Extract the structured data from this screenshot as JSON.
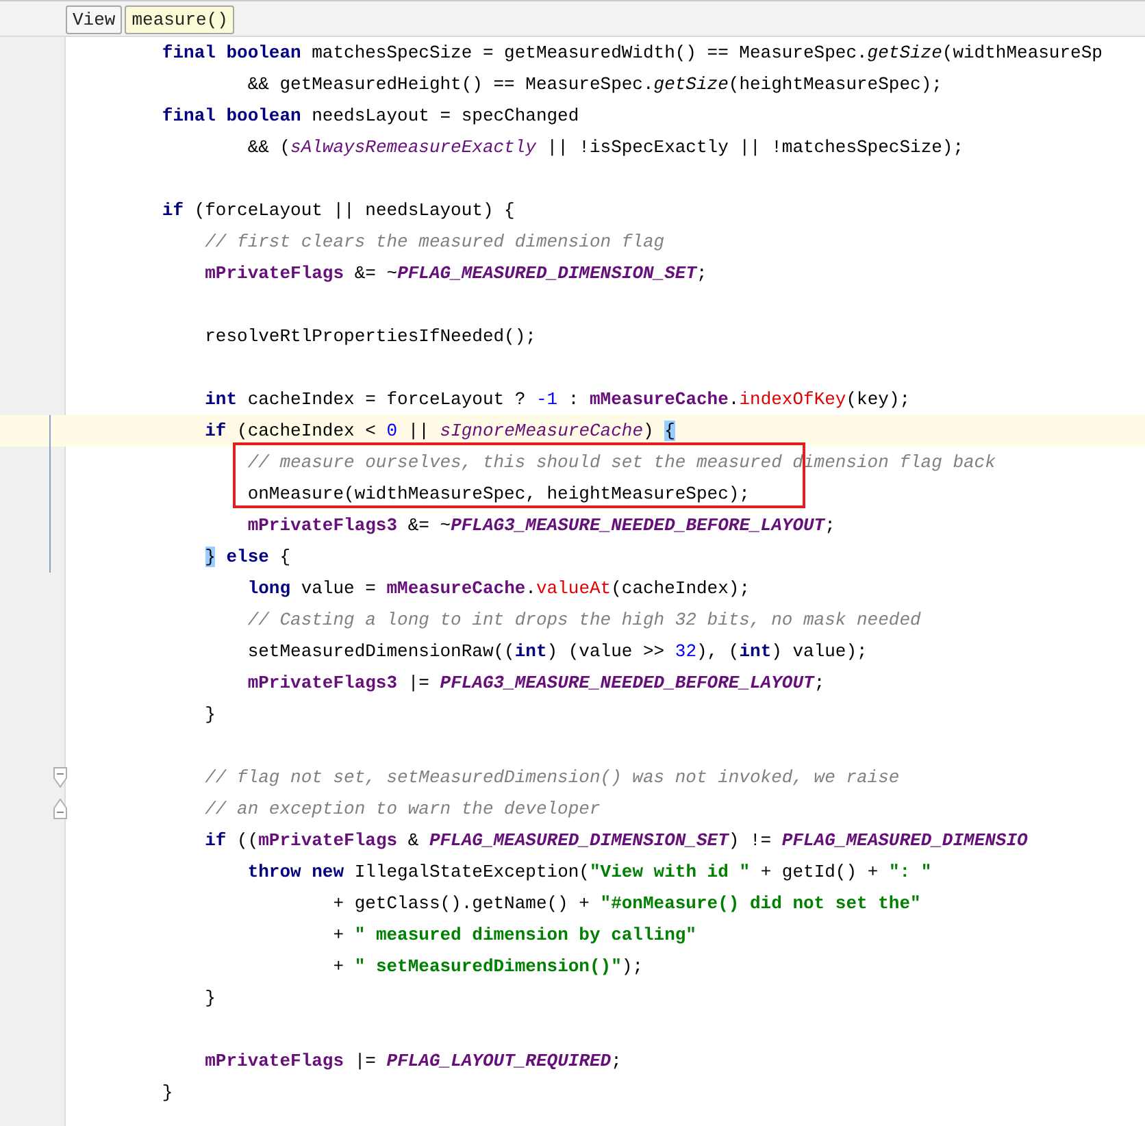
{
  "breadcrumbs": [
    {
      "label": "View",
      "selected": false
    },
    {
      "label": "measure()",
      "selected": true
    }
  ],
  "lines": [
    {
      "kind": "line",
      "current": false,
      "modified": false,
      "tokens": [
        {
          "t": "        final boolean",
          "kind": "keyword"
        },
        {
          "t": " matchesSpecSize = getMeasuredWidth() == MeasureSpec.",
          "kind": "plain"
        },
        {
          "t": "getSize",
          "kind": "italic"
        },
        {
          "t": "(widthMeasureSp",
          "kind": "plain"
        }
      ]
    },
    {
      "kind": "line",
      "current": false,
      "modified": false,
      "tokens": [
        {
          "t": "                && getMeasuredHeight() == MeasureSpec.",
          "kind": "plain"
        },
        {
          "t": "getSize",
          "kind": "italic"
        },
        {
          "t": "(heightMeasureSpec);",
          "kind": "plain"
        }
      ]
    },
    {
      "kind": "line",
      "current": false,
      "modified": false,
      "tokens": [
        {
          "t": "        final boolean",
          "kind": "keyword"
        },
        {
          "t": " needsLayout = specChanged",
          "kind": "plain"
        }
      ]
    },
    {
      "kind": "line",
      "current": false,
      "modified": false,
      "tokens": [
        {
          "t": "                && (",
          "kind": "plain"
        },
        {
          "t": "sAlwaysRemeasureExactly",
          "kind": "static"
        },
        {
          "t": " || !isSpecExactly || !matchesSpecSize);",
          "kind": "plain"
        }
      ]
    },
    {
      "kind": "line",
      "current": false,
      "modified": false
    },
    {
      "kind": "line",
      "current": false,
      "modified": false,
      "tokens": [
        {
          "t": "        if",
          "kind": "keyword"
        },
        {
          "t": " (forceLayout || needsLayout) {",
          "kind": "plain"
        }
      ]
    },
    {
      "kind": "line",
      "current": false,
      "modified": false,
      "tokens": [
        {
          "t": "            // first clears the measured dimension flag",
          "kind": "comment"
        }
      ]
    },
    {
      "kind": "line",
      "current": false,
      "modified": false,
      "tokens": [
        {
          "t": "            mPrivateFlags",
          "kind": "field"
        },
        {
          "t": " &= ~",
          "kind": "plain"
        },
        {
          "t": "PFLAG_MEASURED_DIMENSION_SET",
          "kind": "constant"
        },
        {
          "t": ";",
          "kind": "plain"
        }
      ]
    },
    {
      "kind": "line",
      "current": false,
      "modified": false
    },
    {
      "kind": "line",
      "current": false,
      "modified": false,
      "tokens": [
        {
          "t": "            resolveRtlPropertiesIfNeeded();",
          "kind": "plain"
        }
      ]
    },
    {
      "kind": "line",
      "current": false,
      "modified": false
    },
    {
      "kind": "line",
      "current": false,
      "modified": false,
      "tokens": [
        {
          "t": "            int",
          "kind": "keyword"
        },
        {
          "t": " cacheIndex = forceLayout ? ",
          "kind": "plain"
        },
        {
          "t": "-1",
          "kind": "number"
        },
        {
          "t": " : ",
          "kind": "plain"
        },
        {
          "t": "mMeasureCache",
          "kind": "field"
        },
        {
          "t": ".",
          "kind": "plain"
        },
        {
          "t": "indexOfKey",
          "kind": "call"
        },
        {
          "t": "(key);",
          "kind": "plain"
        }
      ]
    },
    {
      "kind": "line",
      "current": true,
      "modified": true,
      "tokens": [
        {
          "t": "            if",
          "kind": "keyword"
        },
        {
          "t": " (cacheIndex < ",
          "kind": "plain"
        },
        {
          "t": "0",
          "kind": "number"
        },
        {
          "t": " || ",
          "kind": "plain"
        },
        {
          "t": "sIgnoreMeasureCache",
          "kind": "static"
        },
        {
          "t": ") ",
          "kind": "plain"
        },
        {
          "t": "{",
          "kind": "brace"
        }
      ]
    },
    {
      "kind": "line",
      "current": false,
      "modified": true,
      "tokens": [
        {
          "t": "                // measure ourselves, this should set the measured dimension flag back",
          "kind": "comment"
        }
      ]
    },
    {
      "kind": "line",
      "current": false,
      "modified": true,
      "tokens": [
        {
          "t": "                onMeasure(widthMeasureSpec, heightMeasureSpec);",
          "kind": "plain"
        }
      ]
    },
    {
      "kind": "line",
      "current": false,
      "modified": true,
      "tokens": [
        {
          "t": "                mPrivateFlags3",
          "kind": "field"
        },
        {
          "t": " &= ~",
          "kind": "plain"
        },
        {
          "t": "PFLAG3_MEASURE_NEEDED_BEFORE_LAYOUT",
          "kind": "constant"
        },
        {
          "t": ";",
          "kind": "plain"
        }
      ]
    },
    {
      "kind": "line",
      "current": false,
      "modified": true,
      "tokens": [
        {
          "t": "            }",
          "kind": "brace"
        },
        {
          "t": " else",
          "kind": "keyword"
        },
        {
          "t": " {",
          "kind": "plain"
        }
      ]
    },
    {
      "kind": "line",
      "current": false,
      "modified": false,
      "tokens": [
        {
          "t": "                long",
          "kind": "keyword"
        },
        {
          "t": " value = ",
          "kind": "plain"
        },
        {
          "t": "mMeasureCache",
          "kind": "field"
        },
        {
          "t": ".",
          "kind": "plain"
        },
        {
          "t": "valueAt",
          "kind": "call"
        },
        {
          "t": "(cacheIndex);",
          "kind": "plain"
        }
      ]
    },
    {
      "kind": "line",
      "current": false,
      "modified": false,
      "tokens": [
        {
          "t": "                // Casting a long to int drops the high 32 bits, no mask needed",
          "kind": "comment"
        }
      ]
    },
    {
      "kind": "line",
      "current": false,
      "modified": false,
      "tokens": [
        {
          "t": "                setMeasuredDimensionRaw((",
          "kind": "plain"
        },
        {
          "t": "int",
          "kind": "keyword"
        },
        {
          "t": ") (value >> ",
          "kind": "plain"
        },
        {
          "t": "32",
          "kind": "number"
        },
        {
          "t": "), (",
          "kind": "plain"
        },
        {
          "t": "int",
          "kind": "keyword"
        },
        {
          "t": ") value);",
          "kind": "plain"
        }
      ]
    },
    {
      "kind": "line",
      "current": false,
      "modified": false,
      "tokens": [
        {
          "t": "                mPrivateFlags3",
          "kind": "field"
        },
        {
          "t": " |= ",
          "kind": "plain"
        },
        {
          "t": "PFLAG3_MEASURE_NEEDED_BEFORE_LAYOUT",
          "kind": "constant"
        },
        {
          "t": ";",
          "kind": "plain"
        }
      ]
    },
    {
      "kind": "line",
      "current": false,
      "modified": false,
      "tokens": [
        {
          "t": "            }",
          "kind": "plain"
        }
      ]
    },
    {
      "kind": "line",
      "current": false,
      "modified": false
    },
    {
      "kind": "fold-start",
      "current": false,
      "modified": false,
      "tokens": [
        {
          "t": "            // flag not set, setMeasuredDimension() was not invoked, we raise",
          "kind": "comment"
        }
      ]
    },
    {
      "kind": "fold-end",
      "current": false,
      "modified": false,
      "tokens": [
        {
          "t": "            // an exception to warn the developer",
          "kind": "comment"
        }
      ]
    },
    {
      "kind": "line",
      "current": false,
      "modified": false,
      "tokens": [
        {
          "t": "            if",
          "kind": "keyword"
        },
        {
          "t": " ((",
          "kind": "plain"
        },
        {
          "t": "mPrivateFlags",
          "kind": "field"
        },
        {
          "t": " & ",
          "kind": "plain"
        },
        {
          "t": "PFLAG_MEASURED_DIMENSION_SET",
          "kind": "constant"
        },
        {
          "t": ") != ",
          "kind": "plain"
        },
        {
          "t": "PFLAG_MEASURED_DIMENSIO",
          "kind": "constant"
        }
      ]
    },
    {
      "kind": "line",
      "current": false,
      "modified": false,
      "tokens": [
        {
          "t": "                throw new",
          "kind": "keyword"
        },
        {
          "t": " IllegalStateException(",
          "kind": "plain"
        },
        {
          "t": "\"View with id \"",
          "kind": "string"
        },
        {
          "t": " + getId() + ",
          "kind": "plain"
        },
        {
          "t": "\": \"",
          "kind": "string"
        }
      ]
    },
    {
      "kind": "line",
      "current": false,
      "modified": false,
      "tokens": [
        {
          "t": "                        + getClass().getName() + ",
          "kind": "plain"
        },
        {
          "t": "\"#onMeasure() did not set the\"",
          "kind": "string"
        }
      ]
    },
    {
      "kind": "line",
      "current": false,
      "modified": false,
      "tokens": [
        {
          "t": "                        + ",
          "kind": "plain"
        },
        {
          "t": "\" measured dimension by calling\"",
          "kind": "string"
        }
      ]
    },
    {
      "kind": "line",
      "current": false,
      "modified": false,
      "tokens": [
        {
          "t": "                        + ",
          "kind": "plain"
        },
        {
          "t": "\" setMeasuredDimension()\"",
          "kind": "string"
        },
        {
          "t": ");",
          "kind": "plain"
        }
      ]
    },
    {
      "kind": "line",
      "current": false,
      "modified": false,
      "tokens": [
        {
          "t": "            }",
          "kind": "plain"
        }
      ]
    },
    {
      "kind": "line",
      "current": false,
      "modified": false
    },
    {
      "kind": "line",
      "current": false,
      "modified": false,
      "tokens": [
        {
          "t": "            mPrivateFlags",
          "kind": "field"
        },
        {
          "t": " |= ",
          "kind": "plain"
        },
        {
          "t": "PFLAG_LAYOUT_REQUIRED",
          "kind": "constant"
        },
        {
          "t": ";",
          "kind": "plain"
        }
      ]
    },
    {
      "kind": "line",
      "current": false,
      "modified": false,
      "tokens": [
        {
          "t": "        }",
          "kind": "plain"
        }
      ]
    }
  ]
}
